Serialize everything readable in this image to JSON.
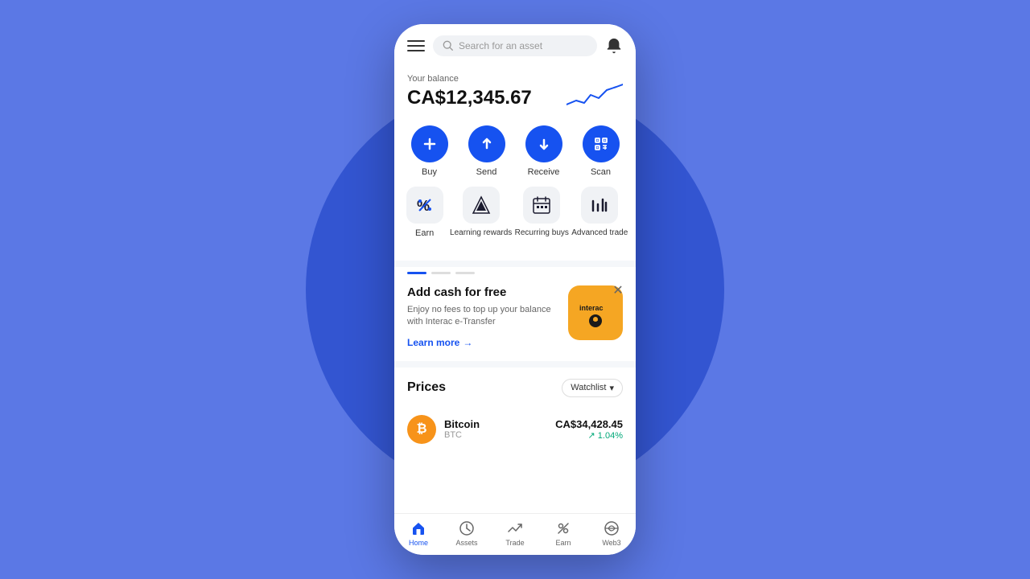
{
  "background": {
    "bg_color": "#5b78e5",
    "circle_color": "#3355d1"
  },
  "header": {
    "search_placeholder": "Search for an asset"
  },
  "balance": {
    "label": "Your balance",
    "amount": "CA$12,345.67"
  },
  "actions_row1": [
    {
      "id": "buy",
      "label": "Buy",
      "icon": "+"
    },
    {
      "id": "send",
      "label": "Send",
      "icon": "↑"
    },
    {
      "id": "receive",
      "label": "Receive",
      "icon": "↓"
    },
    {
      "id": "scan",
      "label": "Scan",
      "icon": "⊡"
    }
  ],
  "actions_row2": [
    {
      "id": "earn",
      "label": "Earn",
      "icon": "%"
    },
    {
      "id": "learning_rewards",
      "label": "Learning rewards",
      "icon": "◆"
    },
    {
      "id": "recurring_buys",
      "label": "Recurring buys",
      "icon": "📅"
    },
    {
      "id": "advanced_trade",
      "label": "Advanced trade",
      "icon": "📊"
    }
  ],
  "promo": {
    "title": "Add cash for free",
    "description": "Enjoy no fees to top up your balance with Interac e-Transfer",
    "link_text": "Learn more",
    "interac_label": "Interac"
  },
  "prices": {
    "title": "Prices",
    "watchlist_label": "Watchlist",
    "assets": [
      {
        "name": "Bitcoin",
        "symbol": "BTC",
        "price": "CA$34,428.45",
        "change": "↗ 1.04%"
      }
    ]
  },
  "bottom_nav": [
    {
      "id": "home",
      "label": "Home",
      "icon": "⌂",
      "active": true
    },
    {
      "id": "assets",
      "label": "Assets",
      "icon": "⏱",
      "active": false
    },
    {
      "id": "trade",
      "label": "Trade",
      "icon": "↗",
      "active": false
    },
    {
      "id": "earn",
      "label": "Earn",
      "icon": "%",
      "active": false
    },
    {
      "id": "web3",
      "label": "Web3",
      "icon": "↻",
      "active": false
    }
  ]
}
